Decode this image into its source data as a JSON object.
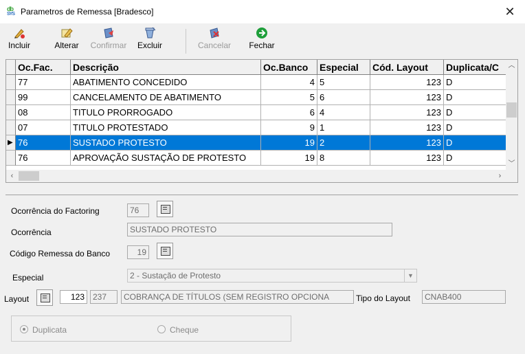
{
  "window": {
    "title": "Parametros de Remessa [Bradesco]",
    "app_icon_text": "db",
    "app_icon_sub": "SYS",
    "close_glyph": "✕"
  },
  "toolbar": [
    {
      "name": "incluir-button",
      "label": "Incluir",
      "icon": "pencil-add-icon",
      "enabled": true
    },
    {
      "name": "alterar-button",
      "label": "Alterar",
      "icon": "pencil-edit-icon",
      "enabled": true
    },
    {
      "name": "confirmar-button",
      "label": "Confirmar",
      "icon": "save-icon",
      "enabled": false
    },
    {
      "name": "excluir-button",
      "label": "Excluir",
      "icon": "delete-icon",
      "enabled": true
    },
    {
      "name": "cancelar-button",
      "label": "Cancelar",
      "icon": "cancel-icon",
      "enabled": false
    },
    {
      "name": "fechar-button",
      "label": "Fechar",
      "icon": "exit-arrow-icon",
      "enabled": true
    }
  ],
  "grid": {
    "columns": [
      "Oc.Fac.",
      "Descrição",
      "Oc.Banco",
      "Especial",
      "Cód. Layout",
      "Duplicata/C"
    ],
    "rows": [
      {
        "ocfac": "77",
        "descricao": "ABATIMENTO CONCEDIDO",
        "ocbanco": "4",
        "especial": "5",
        "layout": "123",
        "dup": "D"
      },
      {
        "ocfac": "99",
        "descricao": "CANCELAMENTO DE ABATIMENTO",
        "ocbanco": "5",
        "especial": "6",
        "layout": "123",
        "dup": "D"
      },
      {
        "ocfac": "08",
        "descricao": "TITULO PRORROGADO",
        "ocbanco": "6",
        "especial": "4",
        "layout": "123",
        "dup": "D"
      },
      {
        "ocfac": "07",
        "descricao": "TITULO PROTESTADO",
        "ocbanco": "9",
        "especial": "1",
        "layout": "123",
        "dup": "D"
      },
      {
        "ocfac": "76",
        "descricao": "SUSTADO PROTESTO",
        "ocbanco": "19",
        "especial": "2",
        "layout": "123",
        "dup": "D"
      },
      {
        "ocfac": "76",
        "descricao": "APROVAÇÃO SUSTAÇÃO DE PROTESTO",
        "ocbanco": "19",
        "especial": "8",
        "layout": "123",
        "dup": "D"
      }
    ],
    "selected_row": 4,
    "selected_color": "#0078d7",
    "record_indicator": "▶"
  },
  "form": {
    "ocorrencia_factoring": {
      "label": "Ocorrência do Factoring",
      "value": "76"
    },
    "ocorrencia": {
      "label": "Ocorrência",
      "value": "SUSTADO PROTESTO"
    },
    "codigo_remessa": {
      "label": "Código Remessa do Banco",
      "value": "19"
    },
    "especial": {
      "label": "Especial",
      "value": "2 - Sustação de Protesto"
    },
    "layout": {
      "label": "Layout",
      "code": "123",
      "id": "237",
      "description": "COBRANÇA DE TÍTULOS (SEM REGISTRO OPCIONA"
    },
    "tipo_layout": {
      "label": "Tipo do Layout",
      "value": "CNAB400"
    },
    "radios": [
      {
        "label": "Duplicata",
        "checked": true
      },
      {
        "label": "Cheque",
        "checked": false
      }
    ]
  }
}
